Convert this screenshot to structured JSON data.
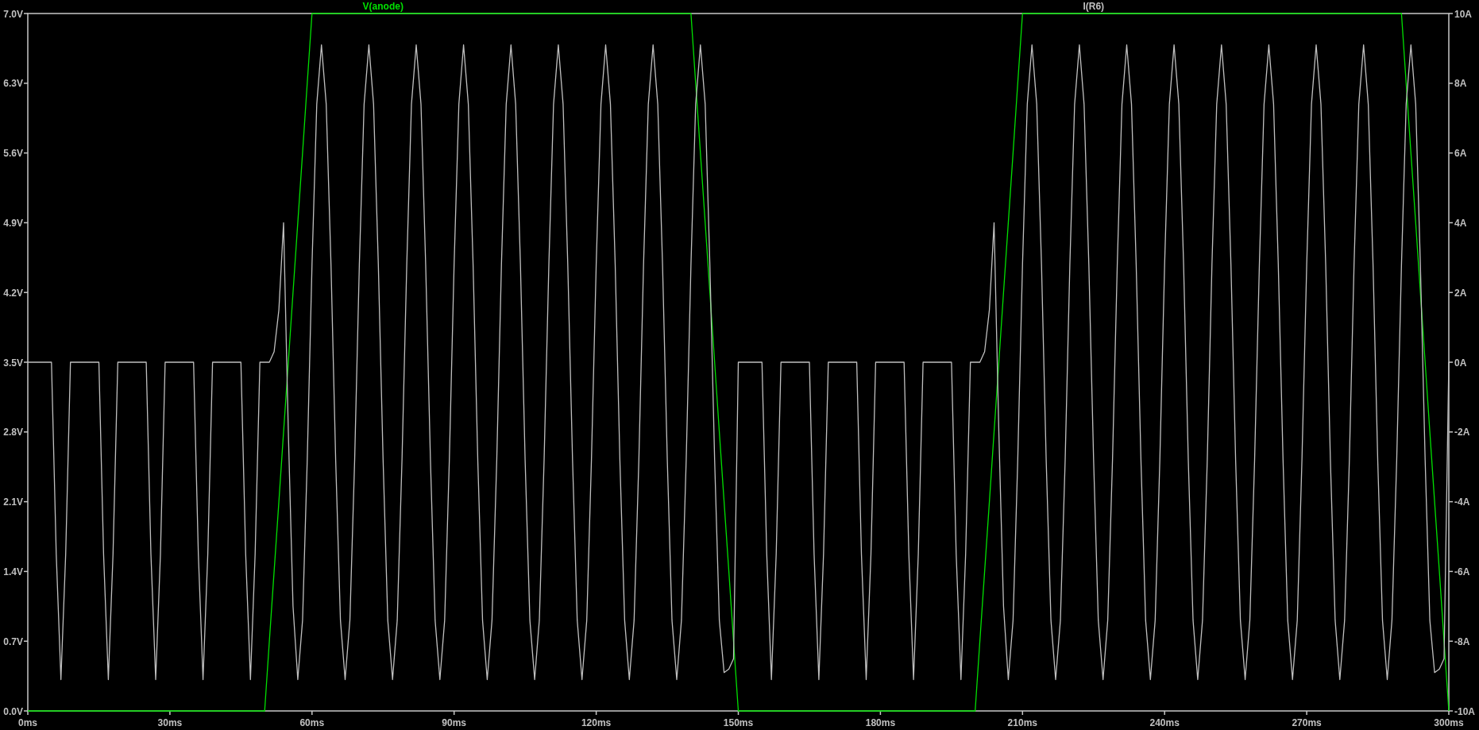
{
  "plot": {
    "chart_data": {
      "type": "line",
      "x": [
        0,
        1,
        2,
        3,
        4,
        5,
        6,
        7,
        8,
        9,
        10,
        11,
        12,
        13,
        14,
        15,
        16,
        17,
        18,
        19,
        20,
        21,
        22,
        23,
        24,
        25,
        26,
        27,
        28,
        29,
        30,
        31,
        32,
        33,
        34,
        35,
        36,
        37,
        38,
        39,
        40,
        41,
        42,
        43,
        44,
        45,
        46,
        47,
        48,
        49,
        50,
        51,
        52,
        53,
        54,
        55,
        56,
        57,
        58,
        59,
        60,
        61,
        62,
        63,
        64,
        65,
        66,
        67,
        68,
        69,
        70,
        71,
        72,
        73,
        74,
        75,
        76,
        77,
        78,
        79,
        80,
        81,
        82,
        83,
        84,
        85,
        86,
        87,
        88,
        89,
        90,
        91,
        92,
        93,
        94,
        95,
        96,
        97,
        98,
        99,
        100,
        101,
        102,
        103,
        104,
        105,
        106,
        107,
        108,
        109,
        110,
        111,
        112,
        113,
        114,
        115,
        116,
        117,
        118,
        119,
        120,
        121,
        122,
        123,
        124,
        125,
        126,
        127,
        128,
        129,
        130,
        131,
        132,
        133,
        134,
        135,
        136,
        137,
        138,
        139,
        140,
        141,
        142,
        143,
        144,
        145,
        146,
        147,
        148,
        149,
        150,
        151,
        152,
        153,
        154,
        155,
        156,
        157,
        158,
        159,
        160,
        161,
        162,
        163,
        164,
        165,
        166,
        167,
        168,
        169,
        170,
        171,
        172,
        173,
        174,
        175,
        176,
        177,
        178,
        179,
        180,
        181,
        182,
        183,
        184,
        185,
        186,
        187,
        188,
        189,
        190,
        191,
        192,
        193,
        194,
        195,
        196,
        197,
        198,
        199,
        200,
        201,
        202,
        203,
        204,
        205,
        206,
        207,
        208,
        209,
        210,
        211,
        212,
        213,
        214,
        215,
        216,
        217,
        218,
        219,
        220,
        221,
        222,
        223,
        224,
        225,
        226,
        227,
        228,
        229,
        230,
        231,
        232,
        233,
        234,
        235,
        236,
        237,
        238,
        239,
        240,
        241,
        242,
        243,
        244,
        245,
        246,
        247,
        248,
        249,
        250,
        251,
        252,
        253,
        254,
        255,
        256,
        257,
        258,
        259,
        260,
        261,
        262,
        263,
        264,
        265,
        266,
        267,
        268,
        269,
        270,
        271,
        272,
        273,
        274,
        275,
        276,
        277,
        278,
        279,
        280,
        281,
        282,
        283,
        284,
        285,
        286,
        287,
        288,
        289,
        290,
        291,
        292,
        293,
        294,
        295,
        296,
        297,
        298,
        299,
        300
      ],
      "series": [
        {
          "name": "V(anode)",
          "color": "#00e000",
          "values": [
            0,
            0,
            0,
            0,
            0,
            0,
            0,
            0,
            0,
            0,
            0,
            0,
            0,
            0,
            0,
            0,
            0,
            0,
            0,
            0,
            0,
            0,
            0,
            0,
            0,
            0,
            0,
            0,
            0,
            0,
            0,
            0,
            0,
            0,
            0,
            0,
            0,
            0,
            0,
            0,
            0,
            0,
            0,
            0,
            0,
            0,
            0,
            0,
            0,
            0,
            0,
            0.7,
            1.4,
            2.1,
            2.8,
            3.5,
            4.2,
            4.9,
            5.6,
            6.3,
            7,
            7,
            7,
            7,
            7,
            7,
            7,
            7,
            7,
            7,
            7,
            7,
            7,
            7,
            7,
            7,
            7,
            7,
            7,
            7,
            7,
            7,
            7,
            7,
            7,
            7,
            7,
            7,
            7,
            7,
            7,
            7,
            7,
            7,
            7,
            7,
            7,
            7,
            7,
            7,
            7,
            7,
            7,
            7,
            7,
            7,
            7,
            7,
            7,
            7,
            7,
            7,
            7,
            7,
            7,
            7,
            7,
            7,
            7,
            7,
            7,
            7,
            7,
            7,
            7,
            7,
            7,
            7,
            7,
            7,
            7,
            7,
            7,
            7,
            7,
            7,
            7,
            7,
            7,
            7,
            7,
            6.3,
            5.6,
            4.9,
            4.2,
            3.5,
            2.8,
            2.1,
            1.4,
            0.7,
            0,
            0,
            0,
            0,
            0,
            0,
            0,
            0,
            0,
            0,
            0,
            0,
            0,
            0,
            0,
            0,
            0,
            0,
            0,
            0,
            0,
            0,
            0,
            0,
            0,
            0,
            0,
            0,
            0,
            0,
            0,
            0,
            0,
            0,
            0,
            0,
            0,
            0,
            0,
            0,
            0,
            0,
            0,
            0,
            0,
            0,
            0,
            0,
            0,
            0,
            0,
            0.7,
            1.4,
            2.1,
            2.8,
            3.5,
            4.2,
            4.9,
            5.6,
            6.3,
            7,
            7,
            7,
            7,
            7,
            7,
            7,
            7,
            7,
            7,
            7,
            7,
            7,
            7,
            7,
            7,
            7,
            7,
            7,
            7,
            7,
            7,
            7,
            7,
            7,
            7,
            7,
            7,
            7,
            7,
            7,
            7,
            7,
            7,
            7,
            7,
            7,
            7,
            7,
            7,
            7,
            7,
            7,
            7,
            7,
            7,
            7,
            7,
            7,
            7,
            7,
            7,
            7,
            7,
            7,
            7,
            7,
            7,
            7,
            7,
            7,
            7,
            7,
            7,
            7,
            7,
            7,
            7,
            7,
            7,
            7,
            7,
            7,
            7,
            7,
            7,
            7,
            7,
            7,
            7,
            7,
            6.3,
            5.6,
            4.9,
            4.2,
            3.5,
            2.8,
            2.1,
            1.4,
            0.7,
            0
          ]
        },
        {
          "name": "I(R6)",
          "color": "#c0c0c0",
          "axis": "y2",
          "values": [
            0,
            0,
            0,
            0,
            0,
            0,
            -5.5,
            -9.1,
            -5.5,
            0,
            0,
            0,
            0,
            0,
            0,
            0,
            -5.5,
            -9.1,
            -5.5,
            0,
            0,
            0,
            0,
            0,
            0,
            0,
            -5.5,
            -9.1,
            -5.5,
            0,
            0,
            0,
            0,
            0,
            0,
            0,
            -5.5,
            -9.1,
            -5.5,
            0,
            0,
            0,
            0,
            0,
            0,
            0,
            -5.5,
            -9.1,
            -5.5,
            0,
            0,
            0,
            0.3,
            1.5,
            4,
            -2,
            -7,
            -9.1,
            -7.4,
            -2.8,
            2.8,
            7.4,
            9.1,
            7.4,
            2.8,
            -2.8,
            -7.4,
            -9.1,
            -7.4,
            -2.8,
            2.8,
            7.4,
            9.1,
            7.4,
            2.8,
            -2.8,
            -7.4,
            -9.1,
            -7.4,
            -2.8,
            2.8,
            7.4,
            9.1,
            7.4,
            2.8,
            -2.8,
            -7.4,
            -9.1,
            -7.4,
            -2.8,
            2.8,
            7.4,
            9.1,
            7.4,
            2.8,
            -2.8,
            -7.4,
            -9.1,
            -7.4,
            -2.8,
            2.8,
            7.4,
            9.1,
            7.4,
            2.8,
            -2.8,
            -7.4,
            -9.1,
            -7.4,
            -2.8,
            2.8,
            7.4,
            9.1,
            7.4,
            2.8,
            -2.8,
            -7.4,
            -9.1,
            -7.4,
            -2.8,
            2.8,
            7.4,
            9.1,
            7.4,
            2.8,
            -2.8,
            -7.4,
            -9.1,
            -7.4,
            -2.8,
            2.8,
            7.4,
            9.1,
            7.4,
            2.8,
            -2.8,
            -7.4,
            -9.1,
            -7.4,
            -2.8,
            2.8,
            7.4,
            9.1,
            7.4,
            2.8,
            -2.8,
            -7.4,
            -8.9,
            -8.8,
            -8.5,
            0,
            0,
            0,
            0,
            0,
            0,
            -5.5,
            -9.1,
            -5.5,
            0,
            0,
            0,
            0,
            0,
            0,
            0,
            -5.5,
            -9.1,
            -5.5,
            0,
            0,
            0,
            0,
            0,
            0,
            0,
            -5.5,
            -9.1,
            -5.5,
            0,
            0,
            0,
            0,
            0,
            0,
            0,
            -5.5,
            -9.1,
            -5.5,
            0,
            0,
            0,
            0,
            0,
            0,
            0,
            -5.5,
            -9.1,
            -5.5,
            0,
            0,
            0,
            0.3,
            1.5,
            4,
            -2,
            -7,
            -9.1,
            -7.4,
            -2.8,
            2.8,
            7.4,
            9.1,
            7.4,
            2.8,
            -2.8,
            -7.4,
            -9.1,
            -7.4,
            -2.8,
            2.8,
            7.4,
            9.1,
            7.4,
            2.8,
            -2.8,
            -7.4,
            -9.1,
            -7.4,
            -2.8,
            2.8,
            7.4,
            9.1,
            7.4,
            2.8,
            -2.8,
            -7.4,
            -9.1,
            -7.4,
            -2.8,
            2.8,
            7.4,
            9.1,
            7.4,
            2.8,
            -2.8,
            -7.4,
            -9.1,
            -7.4,
            -2.8,
            2.8,
            7.4,
            9.1,
            7.4,
            2.8,
            -2.8,
            -7.4,
            -9.1,
            -7.4,
            -2.8,
            2.8,
            7.4,
            9.1,
            7.4,
            2.8,
            -2.8,
            -7.4,
            -9.1,
            -7.4,
            -2.8,
            2.8,
            7.4,
            9.1,
            7.4,
            2.8,
            -2.8,
            -7.4,
            -9.1,
            -7.4,
            -2.8,
            2.8,
            7.4,
            9.1,
            7.4,
            2.8,
            -2.8,
            -7.4,
            -9.1,
            -7.4,
            -2.8,
            2.8,
            7.4,
            9.1,
            7.4,
            2.8,
            -2.8,
            -7.4,
            -8.9,
            -8.8,
            -8.5,
            0
          ]
        }
      ],
      "xlim": [
        0,
        300
      ],
      "ylim": [
        0,
        7
      ],
      "y2lim": [
        -10,
        10
      ],
      "xticks": [
        {
          "value": 0,
          "label": "0ms"
        },
        {
          "value": 30,
          "label": "30ms"
        },
        {
          "value": 60,
          "label": "60ms"
        },
        {
          "value": 90,
          "label": "90ms"
        },
        {
          "value": 120,
          "label": "120ms"
        },
        {
          "value": 150,
          "label": "150ms"
        },
        {
          "value": 180,
          "label": "180ms"
        },
        {
          "value": 210,
          "label": "210ms"
        },
        {
          "value": 240,
          "label": "240ms"
        },
        {
          "value": 270,
          "label": "270ms"
        },
        {
          "value": 300,
          "label": "300ms"
        }
      ],
      "yticks": [
        {
          "value": 0,
          "label": "0.0V"
        },
        {
          "value": 0.7,
          "label": "0.7V"
        },
        {
          "value": 1.4,
          "label": "1.4V"
        },
        {
          "value": 2.1,
          "label": "2.1V"
        },
        {
          "value": 2.8,
          "label": "2.8V"
        },
        {
          "value": 3.5,
          "label": "3.5V"
        },
        {
          "value": 4.2,
          "label": "4.2V"
        },
        {
          "value": 4.9,
          "label": "4.9V"
        },
        {
          "value": 5.6,
          "label": "5.6V"
        },
        {
          "value": 6.3,
          "label": "6.3V"
        },
        {
          "value": 7,
          "label": "7.0V"
        }
      ],
      "y2ticks": [
        {
          "value": -10,
          "label": "-10A"
        },
        {
          "value": -8,
          "label": "-8A"
        },
        {
          "value": -6,
          "label": "-6A"
        },
        {
          "value": -4,
          "label": "-4A"
        },
        {
          "value": -2,
          "label": "-2A"
        },
        {
          "value": 0,
          "label": "0A"
        },
        {
          "value": 2,
          "label": "2A"
        },
        {
          "value": 4,
          "label": "4A"
        },
        {
          "value": 6,
          "label": "6A"
        },
        {
          "value": 8,
          "label": "8A"
        },
        {
          "value": 10,
          "label": "10A"
        }
      ]
    }
  }
}
